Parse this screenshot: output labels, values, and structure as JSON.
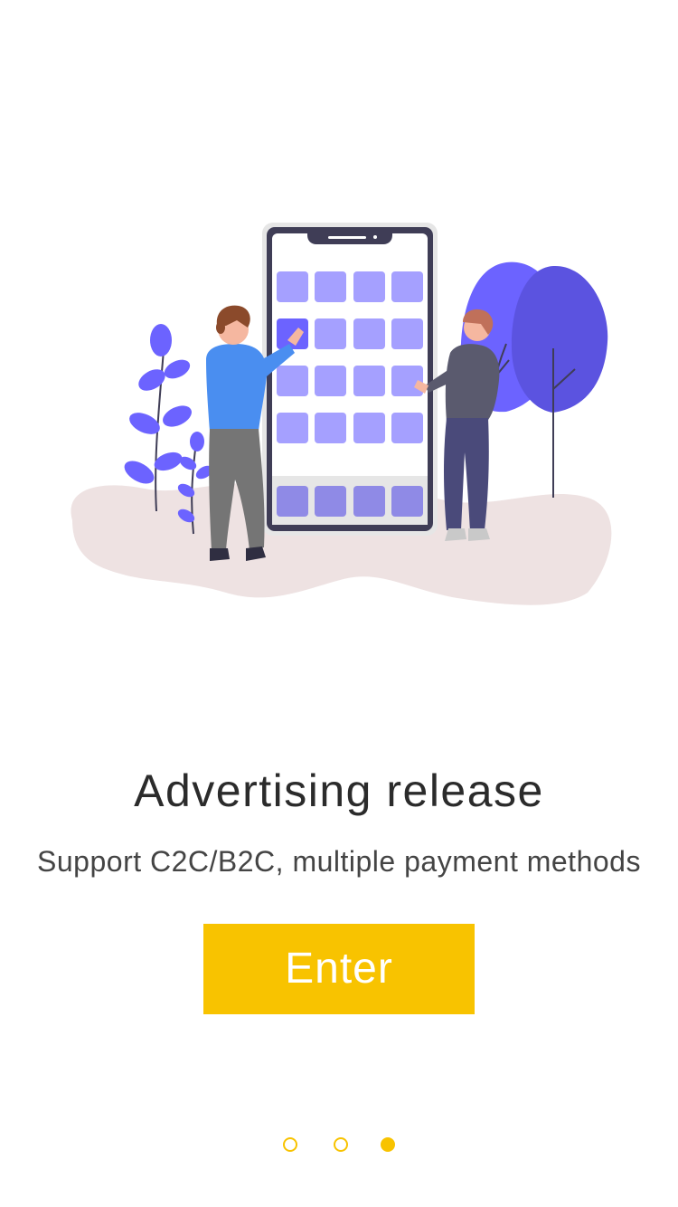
{
  "onboarding": {
    "title": "Advertising release",
    "subtitle": "Support C2C/B2C, multiple payment methods",
    "enter_label": "Enter",
    "illustration_icon": "people-with-phone-app-grid-illustration"
  },
  "pagination": {
    "total": 3,
    "active_index": 3
  },
  "colors": {
    "accent": "#F8C300",
    "title_text": "#2B2B2B",
    "subtitle_text": "#444444",
    "illustration_purple": "#6C63FF",
    "illustration_ground": "#EEE2E2"
  }
}
